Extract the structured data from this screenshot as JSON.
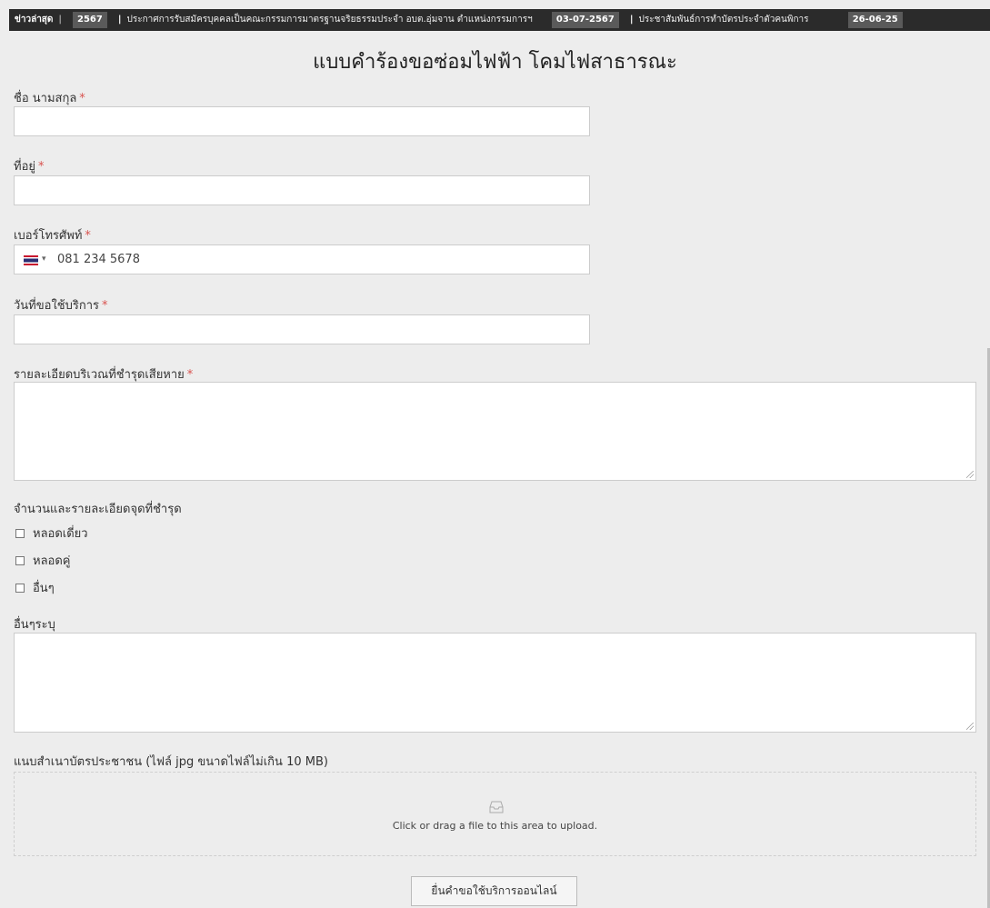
{
  "ticker": {
    "lead": "ข่าวล่าสุด",
    "items": [
      {
        "date": "2567",
        "headline": "ประกาศการรับสมัครบุคคลเป็นคณะกรรมการมาตรฐานจริยธรรมประจำ อบต.อุ่มจาน ตำแหน่งกรรมการฯ"
      },
      {
        "date": "03-07-2567",
        "headline": "ประชาสัมพันธ์การทำบัตรประจำตัวคนพิการ"
      },
      {
        "date": "26-06-25",
        "headline": ""
      }
    ]
  },
  "form": {
    "title": "แบบคำร้องขอซ่อมไฟฟ้า โคมไฟสาธารณะ",
    "fields": {
      "name_label": "ชื่อ นามสกุล",
      "address_label": "ที่อยู่",
      "phone_label": "เบอร์โทรศัพท์",
      "phone_placeholder": "081 234 5678",
      "date_label": "วันที่ขอใช้บริการ",
      "detail_label": "รายละเอียดบริเวณที่ชำรุดเสียหาย",
      "points_label": "จำนวนและรายละเอียดจุดที่ชำรุด",
      "other_label": "อื่นๆระบุ",
      "attach_label": "แนบสำเนาบัตรประชาชน (ไฟล์ jpg ขนาดไฟล์ไม่เกิน 10 MB)"
    },
    "required_mark": "*",
    "options": [
      "หลอดเดี่ยว",
      "หลอดคู่",
      "อื่นๆ"
    ],
    "upload_text": "Click or drag a file to this area to upload.",
    "submit_label": "ยื่นคำขอใช้บริการออนไลน์"
  },
  "icons": {
    "flag": "thailand-flag-icon",
    "upload": "inbox-icon"
  }
}
